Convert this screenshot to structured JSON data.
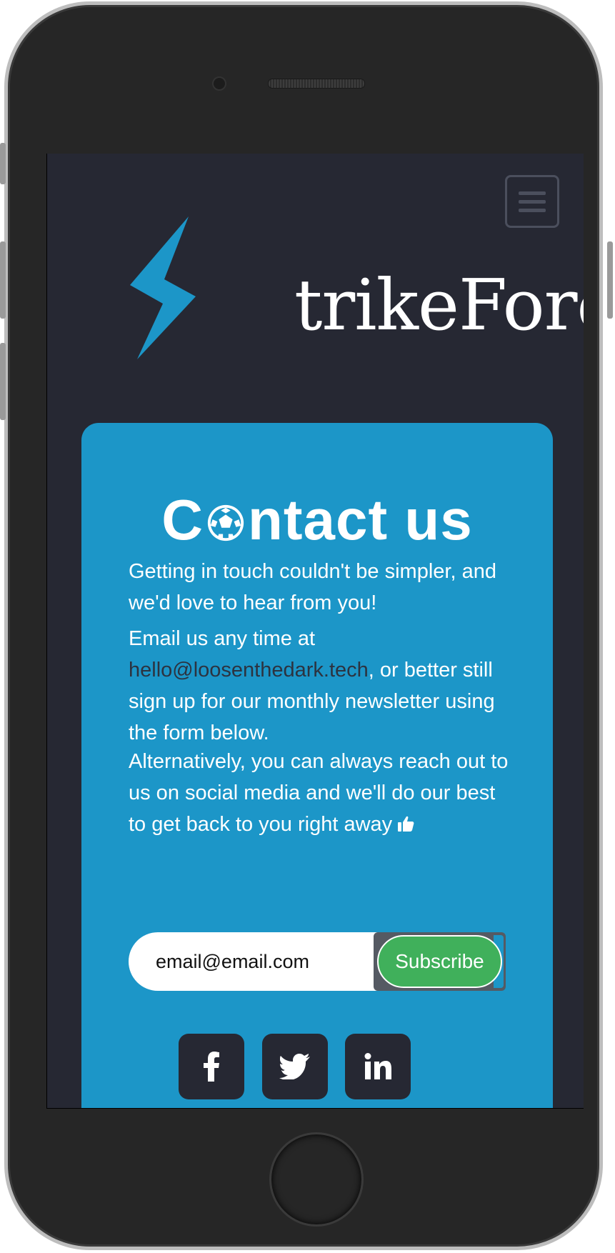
{
  "header": {
    "logo_text": "trikeForce",
    "menu_icon": "hamburger-icon"
  },
  "contact": {
    "title_start": "C",
    "title_end": "ntact us",
    "title_icon": "soccer-ball-icon",
    "p1": "Getting in touch couldn't be simpler, and we'd love to hear from you!",
    "p2_before": "Email us any time at ",
    "email_link": "hello@loosenthedark.tech",
    "p2_after": ", or better still sign up for our monthly newsletter using the form below.",
    "p3": "Alternatively, you can always reach out to us on social media and we'll do our best to get back to you right away",
    "p3_icon": "thumbs-up-icon"
  },
  "newsletter": {
    "email_value": "email@email.com",
    "subscribe_label": "Subscribe"
  },
  "social": [
    {
      "name": "facebook",
      "icon": "facebook-icon"
    },
    {
      "name": "twitter",
      "icon": "twitter-icon"
    },
    {
      "name": "linkedin",
      "icon": "linkedin-icon"
    }
  ],
  "colors": {
    "background": "#262833",
    "card": "#1c96c8",
    "subscribe": "#40b05b",
    "link": "#2c3340"
  }
}
